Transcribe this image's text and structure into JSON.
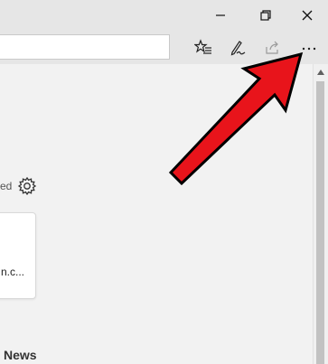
{
  "window": {
    "minimize_icon": "minimize-icon",
    "restore_icon": "restore-icon",
    "close_icon": "close-icon"
  },
  "toolbar": {
    "address_value": "",
    "icons": [
      "favorites-bar-star-icon",
      "web-notes-pen-icon",
      "share-icon",
      "more-ellipsis-icon"
    ],
    "more_label": "···"
  },
  "content": {
    "personalized_text": "ed",
    "card_text": "n.c...",
    "news_heading": "News"
  },
  "annotation": {
    "arrow_color": "#e8141b"
  }
}
